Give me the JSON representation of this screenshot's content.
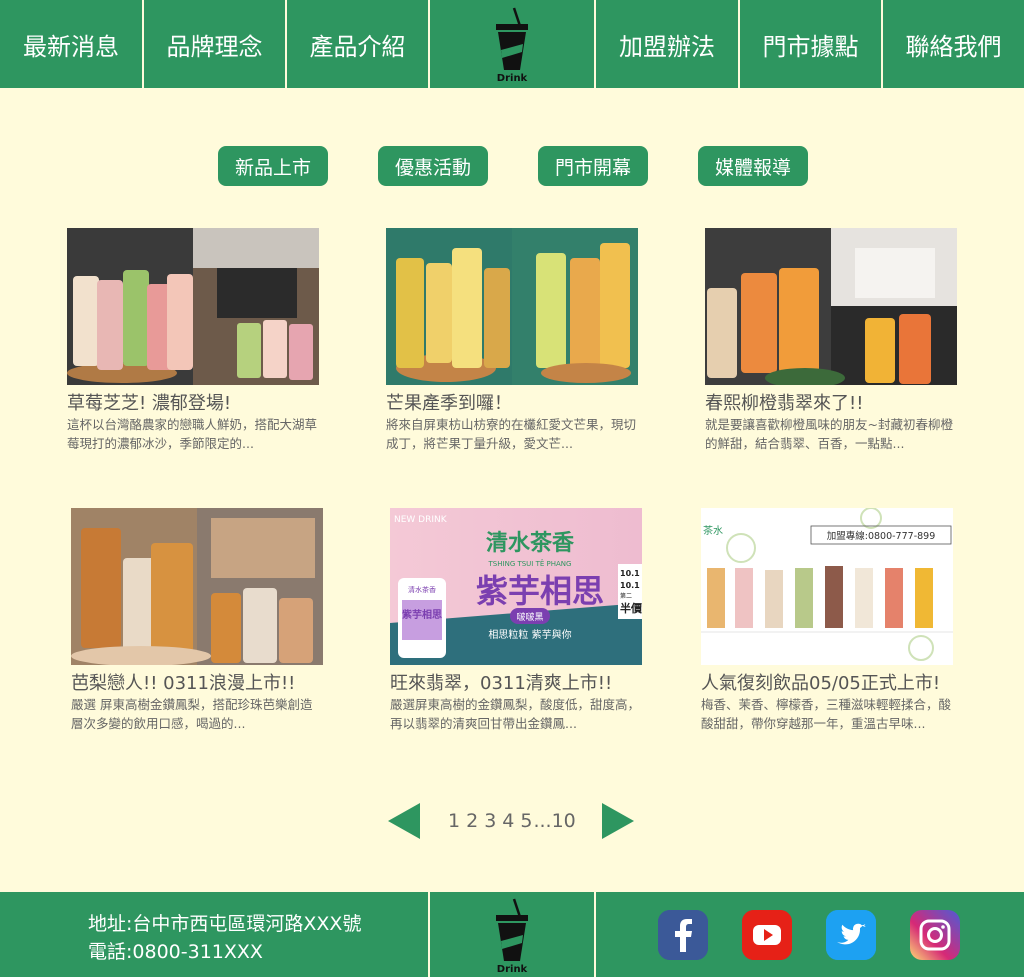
{
  "nav": {
    "items_left": [
      "最新消息",
      "品牌理念",
      "產品介紹"
    ],
    "logo_text": "Drink",
    "items_right": [
      "加盟辦法",
      "門市據點",
      "聯絡我們"
    ]
  },
  "tabs": [
    "新品上市",
    "優惠活動",
    "門市開幕",
    "媒體報導"
  ],
  "articles": [
    {
      "title": "草莓芝芝! 濃郁登場!",
      "desc": "這杯以台灣酪農家的戀職人鮮奶，搭配大湖草莓現打的濃郁冰沙，季節限定的..."
    },
    {
      "title": "芒果產季到囉！",
      "desc": "將來自屏東枋山枋寮的在欉紅愛文芒果，現切成丁，將芒果丁量升級，愛文芒..."
    },
    {
      "title": "春熙柳橙翡翠來了!!",
      "desc": "就是要讓喜歡柳橙風味的朋友~封藏初春柳橙的鮮甜，結合翡翠、百香，一點點..."
    },
    {
      "title": "芭梨戀人!! 0311浪漫上市!!",
      "desc": "嚴選 屏東高樹金鑽鳳梨，搭配珍珠芭樂創造層次多變的飲用口感，喝過的..."
    },
    {
      "title": "旺來翡翠，0311清爽上市!!",
      "desc": "嚴選屏東高樹的金鑽鳳梨，酸度低，甜度高，再以翡翠的清爽回甘帶出金鑽鳳..."
    },
    {
      "title": "人氣復刻飲品05/05正式上市!",
      "desc": "梅香、茉香、檸檬香，三種滋味輕輕揉合，酸酸甜甜，帶你穿越那一年，重溫古早味..."
    }
  ],
  "banner": {
    "brand": "NEW DRINK",
    "title": "清水茶香",
    "roman": "TSHING TSUI TÊ PHANG",
    "big": "紫芋相思",
    "badge": "啵啵黑",
    "cup_label": "紫芋相思",
    "tag": "清水茶香",
    "subtitle": "相思粒粒 紫芋與你",
    "date1": "10.1",
    "date2": "10.1",
    "promo_line": "第二",
    "promo_big": "半價"
  },
  "retro": {
    "logo": "茶水",
    "hotline": "加盟專線:0800-777-899"
  },
  "pagination": {
    "pages": [
      "1",
      "2",
      "3",
      "4",
      "5",
      "...10"
    ]
  },
  "footer": {
    "address": "地址:台中市西屯區環河路XXX號",
    "phone": "電話:0800-311XXX",
    "logo_text": "Drink",
    "social": [
      "facebook-icon",
      "youtube-icon",
      "twitter-icon",
      "instagram-icon"
    ]
  },
  "colors": {
    "primary": "#2e9660",
    "background": "#fffbdb"
  }
}
